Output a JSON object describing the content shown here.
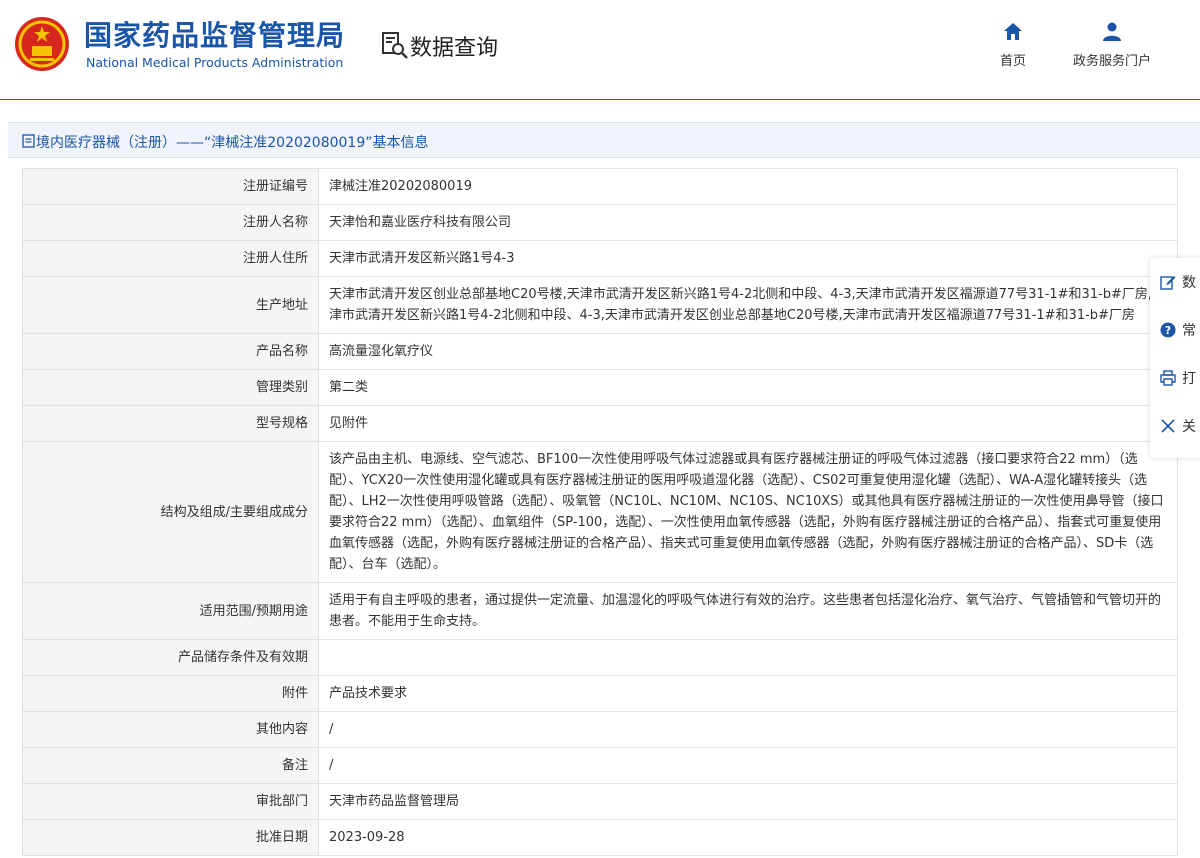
{
  "header": {
    "org_name_cn": "国家药品监督管理局",
    "org_name_en": "National Medical Products Administration",
    "system_title": "数据查询",
    "nav": [
      {
        "label": "首页",
        "icon": "home-icon"
      },
      {
        "label": "政务服务门户",
        "icon": "user-icon"
      }
    ]
  },
  "section": {
    "title": "境内医疗器械（注册）——“津械注准20202080019”基本信息"
  },
  "rows": [
    {
      "label": "注册证编号",
      "value": "津械注准20202080019"
    },
    {
      "label": "注册人名称",
      "value": "天津怡和嘉业医疗科技有限公司"
    },
    {
      "label": "注册人住所",
      "value": "天津市武清开发区新兴路1号4-3"
    },
    {
      "label": "生产地址",
      "value": "天津市武清开发区创业总部基地C20号楼,天津市武清开发区新兴路1号4-2北侧和中段、4-3,天津市武清开发区福源道77号31-1#和31-b#厂房,天津市武清开发区新兴路1号4-2北侧和中段、4-3,天津市武清开发区创业总部基地C20号楼,天津市武清开发区福源道77号31-1#和31-b#厂房"
    },
    {
      "label": "产品名称",
      "value": "高流量湿化氧疗仪"
    },
    {
      "label": "管理类别",
      "value": "第二类"
    },
    {
      "label": "型号规格",
      "value": "见附件"
    },
    {
      "label": "结构及组成/主要组成成分",
      "value": "该产品由主机、电源线、空气滤芯、BF100一次性使用呼吸气体过滤器或具有医疗器械注册证的呼吸气体过滤器（接口要求符合22 mm）（选配）、YCX20一次性使用湿化罐或具有医疗器械注册证的医用呼吸道湿化器（选配）、CS02可重复使用湿化罐（选配）、WA-A湿化罐转接头（选配）、LH2一次性使用呼吸管路（选配）、吸氧管（NC10L、NC10M、NC10S、NC10XS）或其他具有医疗器械注册证的一次性使用鼻导管（接口要求符合22 mm）（选配）、血氧组件（SP-100，选配）、一次性使用血氧传感器（选配，外购有医疗器械注册证的合格产品）、指套式可重复使用血氧传感器（选配，外购有医疗器械注册证的合格产品）、指夹式可重复使用血氧传感器（选配，外购有医疗器械注册证的合格产品）、SD卡（选配）、台车（选配）。"
    },
    {
      "label": "适用范围/预期用途",
      "value": "适用于有自主呼吸的患者，通过提供一定流量、加温湿化的呼吸气体进行有效的治疗。这些患者包括湿化治疗、氧气治疗、气管插管和气管切开的患者。不能用于生命支持。"
    },
    {
      "label": "产品储存条件及有效期",
      "value": ""
    },
    {
      "label": "附件",
      "value": "产品技术要求"
    },
    {
      "label": "其他内容",
      "value": "/"
    },
    {
      "label": "备注",
      "value": "/"
    },
    {
      "label": "审批部门",
      "value": "天津市药品监督管理局"
    },
    {
      "label": "批准日期",
      "value": "2023-09-28"
    }
  ],
  "float_panel": [
    {
      "label": "数",
      "icon": "edit-icon"
    },
    {
      "label": "常",
      "icon": "help-icon"
    },
    {
      "label": "打",
      "icon": "print-icon"
    },
    {
      "label": "关",
      "icon": "close-icon"
    }
  ],
  "colors": {
    "brand_blue": "#1b55a8",
    "emblem_red": "#d7261e",
    "emblem_gold": "#f4c400"
  }
}
